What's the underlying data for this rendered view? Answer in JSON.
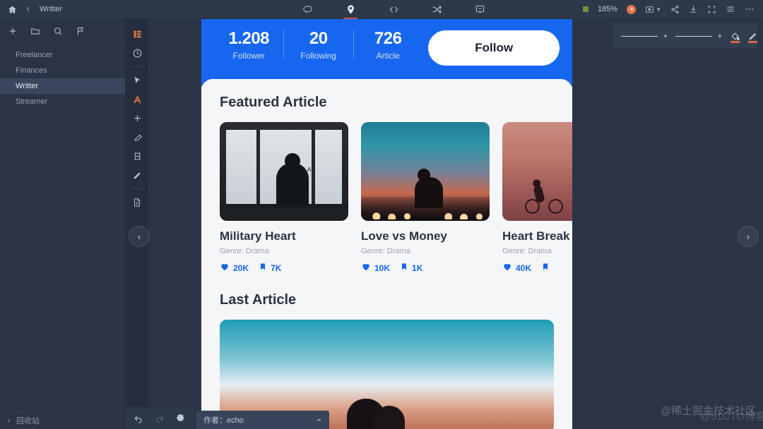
{
  "titlebar": {
    "home_icon": "home-icon",
    "back_icon": "chevron-left-icon",
    "title": "Writter",
    "center_tools": [
      {
        "name": "comment-icon",
        "label": "Comment",
        "active": false
      },
      {
        "name": "location-pin-icon",
        "label": "Pin",
        "active": true
      },
      {
        "name": "code-icon",
        "label": "Code",
        "active": false
      },
      {
        "name": "shuffle-icon",
        "label": "Shuffle",
        "active": false
      },
      {
        "name": "presentation-icon",
        "label": "Present",
        "active": false
      }
    ],
    "zoom_level": "185%",
    "right_tools": [
      {
        "name": "record-button",
        "label": "Record"
      },
      {
        "name": "play-dropdown",
        "label": "Play"
      },
      {
        "name": "share-icon",
        "label": "Share"
      },
      {
        "name": "download-icon",
        "label": "Download"
      },
      {
        "name": "fullscreen-icon",
        "label": "Fullscreen"
      },
      {
        "name": "menu-icon",
        "label": "Menu"
      },
      {
        "name": "more-icon",
        "label": "More"
      }
    ]
  },
  "sidebar": {
    "tools": [
      {
        "name": "add-icon",
        "label": "New"
      },
      {
        "name": "folder-icon",
        "label": "Folder"
      },
      {
        "name": "search-icon",
        "label": "Search"
      },
      {
        "name": "flag-icon",
        "label": "Flag"
      }
    ],
    "items": [
      {
        "label": "Freelancer",
        "selected": false
      },
      {
        "label": "Finances",
        "selected": false
      },
      {
        "label": "Writter",
        "selected": true
      },
      {
        "label": "Streamer",
        "selected": false
      }
    ],
    "recycle_bin": "回收站"
  },
  "rail": {
    "tools": [
      {
        "name": "layers-icon",
        "label": "Layers",
        "active": true
      },
      {
        "name": "history-icon",
        "label": "History",
        "active": false
      },
      {
        "name": "pointer-icon",
        "label": "Select",
        "active": false
      },
      {
        "name": "text-icon",
        "label": "Text",
        "active": true
      },
      {
        "name": "add-shape-icon",
        "label": "Add",
        "active": false
      },
      {
        "name": "eraser-icon",
        "label": "Eraser",
        "active": false
      },
      {
        "name": "component-icon",
        "label": "Component",
        "active": false
      },
      {
        "name": "pencil-icon",
        "label": "Pencil",
        "active": false
      },
      {
        "name": "page-icon",
        "label": "Page",
        "active": false
      }
    ]
  },
  "properties_panel": {
    "stroke_style": "solid-line",
    "second_style": "solid-line",
    "fill_icon": "fill-bucket-icon",
    "brush_icon": "brush-icon",
    "text_color_icon": "text-color-icon",
    "accent_color": "#d4694a"
  },
  "mockup": {
    "accent_color": "#1666f0",
    "stats": [
      {
        "value": "1.208",
        "label": "Follower"
      },
      {
        "value": "20",
        "label": "Following"
      },
      {
        "value": "726",
        "label": "Article"
      }
    ],
    "follow_button": "Follow",
    "featured_title": "Featured Article",
    "featured_cards": [
      {
        "title": "Military Heart",
        "genre": "Genre: Drama",
        "likes": "20K",
        "saves": "7K"
      },
      {
        "title": "Love vs Money",
        "genre": "Genre: Drama",
        "likes": "10K",
        "saves": "1K"
      },
      {
        "title": "Heart Break",
        "genre": "Genre: Drama",
        "likes": "40K",
        "saves": ""
      }
    ],
    "last_title": "Last Article",
    "nav_prev": "‹",
    "nav_next": "›"
  },
  "bottombar": {
    "undo": "undo-icon",
    "redo": "redo-icon",
    "settings": "gear-icon",
    "author_label": "作者：echo",
    "collapse": "chevron-up-icon"
  },
  "watermarks": {
    "primary": "@稀土掘金技术社区",
    "secondary": "@51CTO博客"
  }
}
